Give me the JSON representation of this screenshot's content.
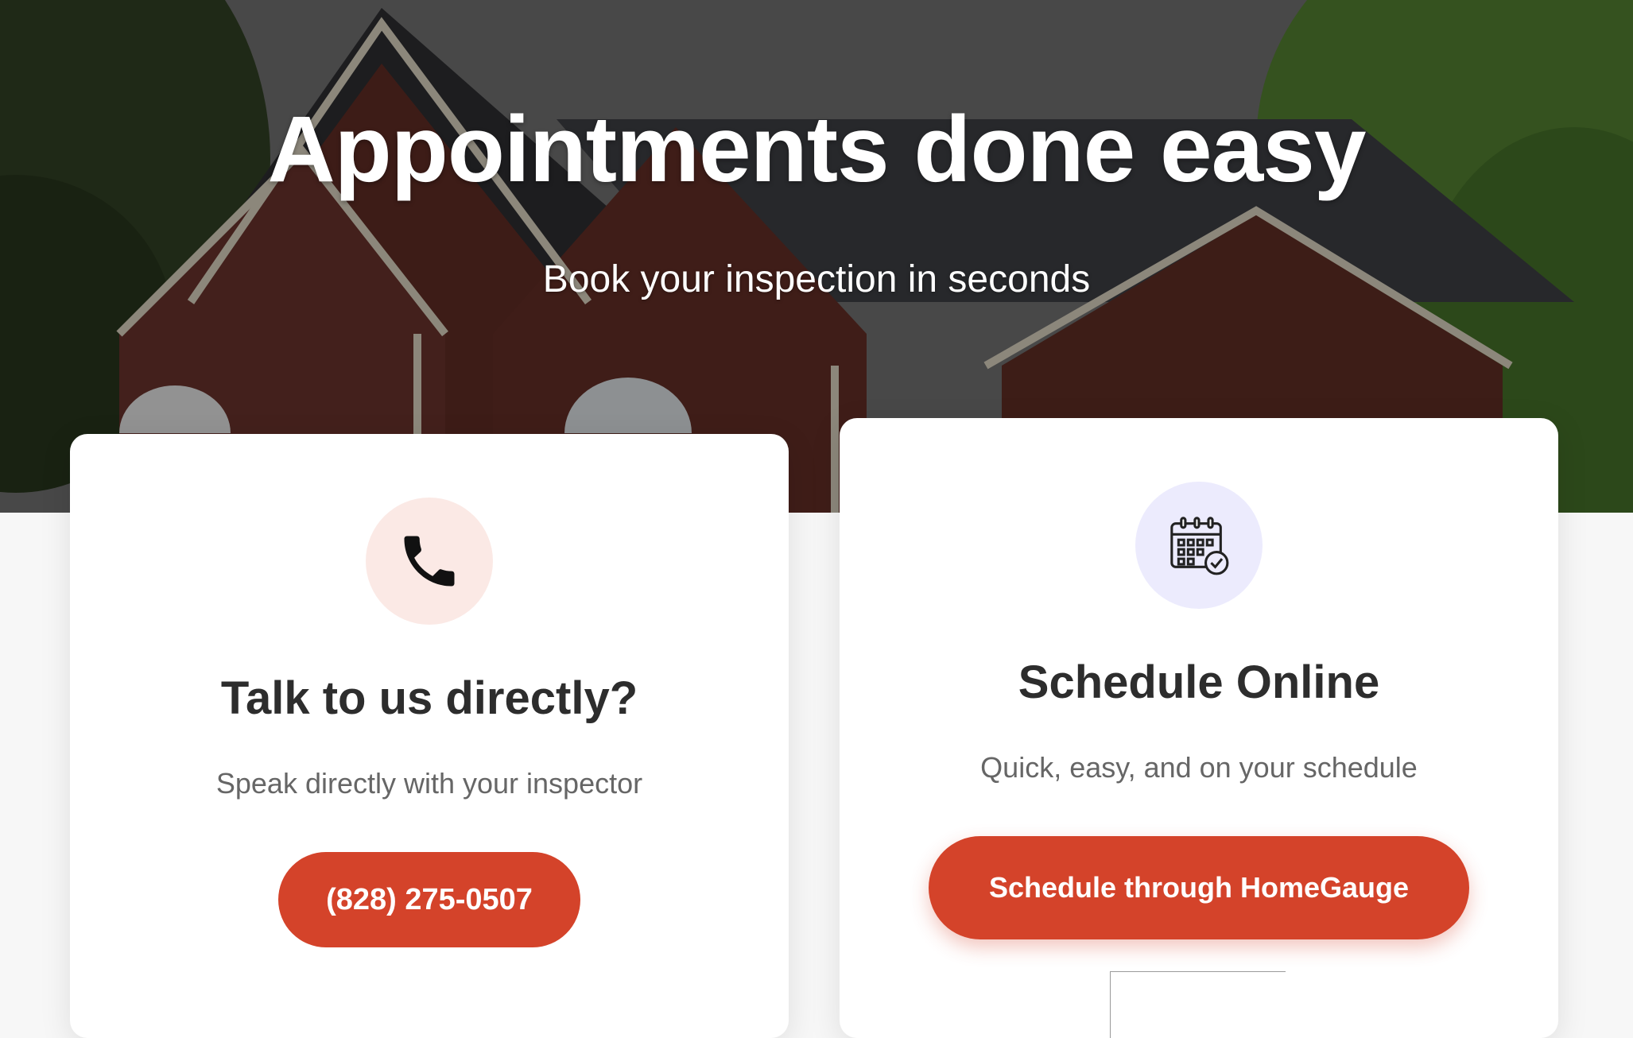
{
  "hero": {
    "title": "Appointments done easy",
    "subtitle": "Book your inspection in seconds"
  },
  "cards": {
    "phone": {
      "icon": "phone-icon",
      "title": "Talk to us directly?",
      "description": "Speak directly with your inspector",
      "button_label": "(828) 275-0507"
    },
    "online": {
      "icon": "calendar-check-icon",
      "title": "Schedule Online",
      "description": "Quick, easy, and on your schedule",
      "button_label": "Schedule through HomeGauge"
    }
  },
  "colors": {
    "accent": "#d4432a",
    "phone_icon_bg": "#fbe9e5",
    "calendar_icon_bg": "#ecebfd",
    "title_text": "#2d2d2d",
    "body_text": "#666666",
    "page_bg": "#f7f7f7"
  }
}
